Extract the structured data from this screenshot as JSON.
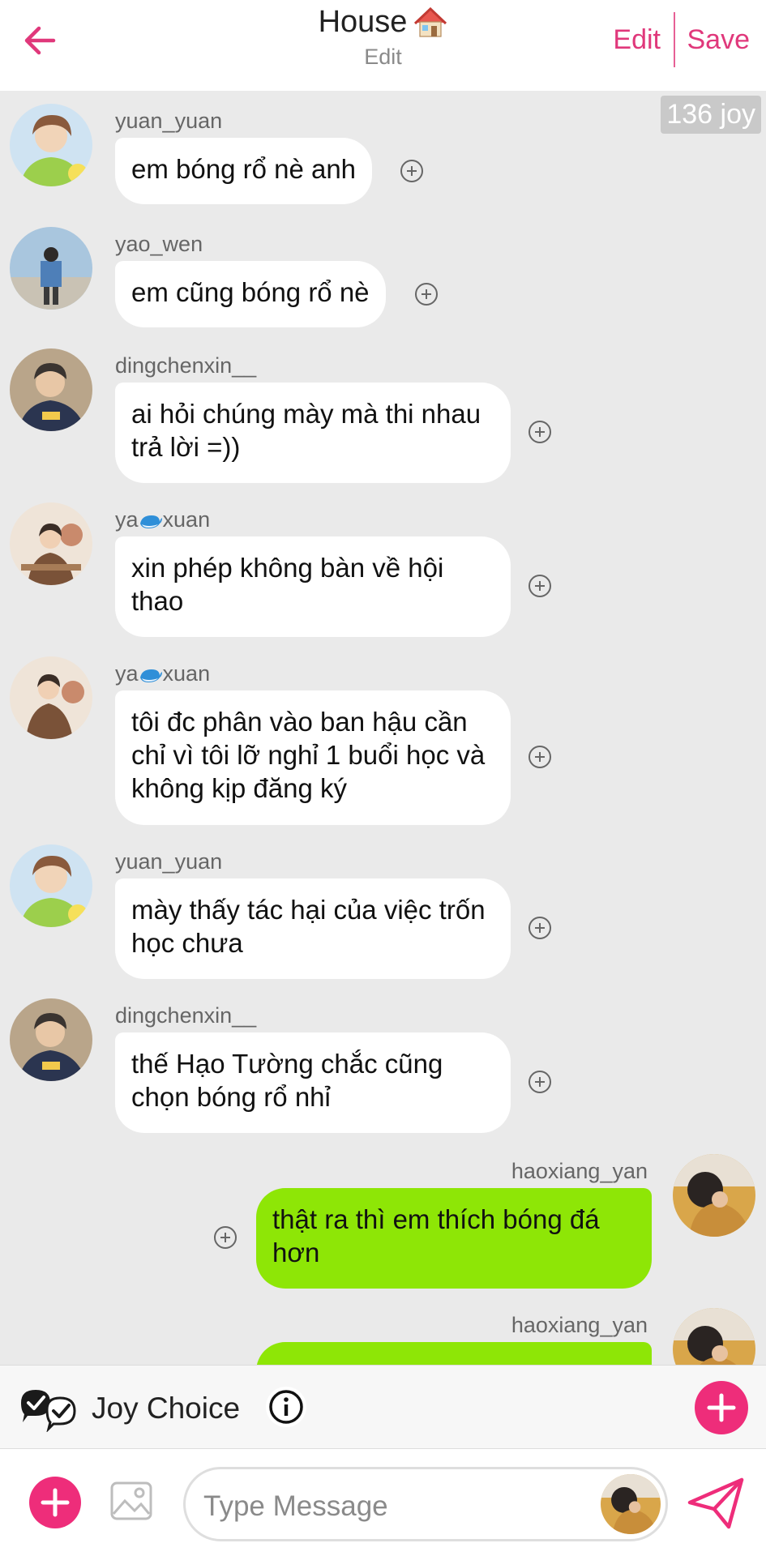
{
  "header": {
    "title": "House",
    "title_icon": "house-emoji-icon",
    "subtitle": "Edit",
    "edit_label": "Edit",
    "save_label": "Save"
  },
  "badge": {
    "joy": "136 joy"
  },
  "messages": [
    {
      "user": "yuan_yuan",
      "text": "em bóng rổ nè anh",
      "side": "in"
    },
    {
      "user": "yao_wen",
      "text": "em cũng bóng rổ nè",
      "side": "in"
    },
    {
      "user": "dingchenxin__",
      "text": "ai hỏi chúng mày mà thi nhau trả lời =))",
      "side": "in"
    },
    {
      "user_prefix": "ya",
      "user_suffix": "xuan",
      "user_icon": "whale-icon",
      "text": "xin phép không bàn về hội thao",
      "side": "in"
    },
    {
      "user_prefix": "ya",
      "user_suffix": "xuan",
      "user_icon": "whale-icon",
      "text": "tôi đc phân vào ban hậu cần chỉ vì tôi lỡ nghỉ 1 buổi học và không kịp đăng ký",
      "side": "in"
    },
    {
      "user": "yuan_yuan",
      "text": "mày thấy tác hại của việc trốn học chưa",
      "side": "in"
    },
    {
      "user": "dingchenxin__",
      "text": "thế Hạo Tường chắc cũng chọn bóng rổ nhỉ",
      "side": "in"
    },
    {
      "user": "haoxiang_yan",
      "text": "thật ra thì em thích bóng đá hơn",
      "side": "out"
    },
    {
      "user": "haoxiang_yan",
      "text": "",
      "side": "out"
    }
  ],
  "joybar": {
    "label": "Joy Choice"
  },
  "input": {
    "placeholder": "Type Message"
  },
  "colors": {
    "accent": "#e0387b",
    "outgoing_bubble": "#8ee606",
    "incoming_bubble": "#ffffff",
    "chat_bg": "#eaeaea"
  }
}
